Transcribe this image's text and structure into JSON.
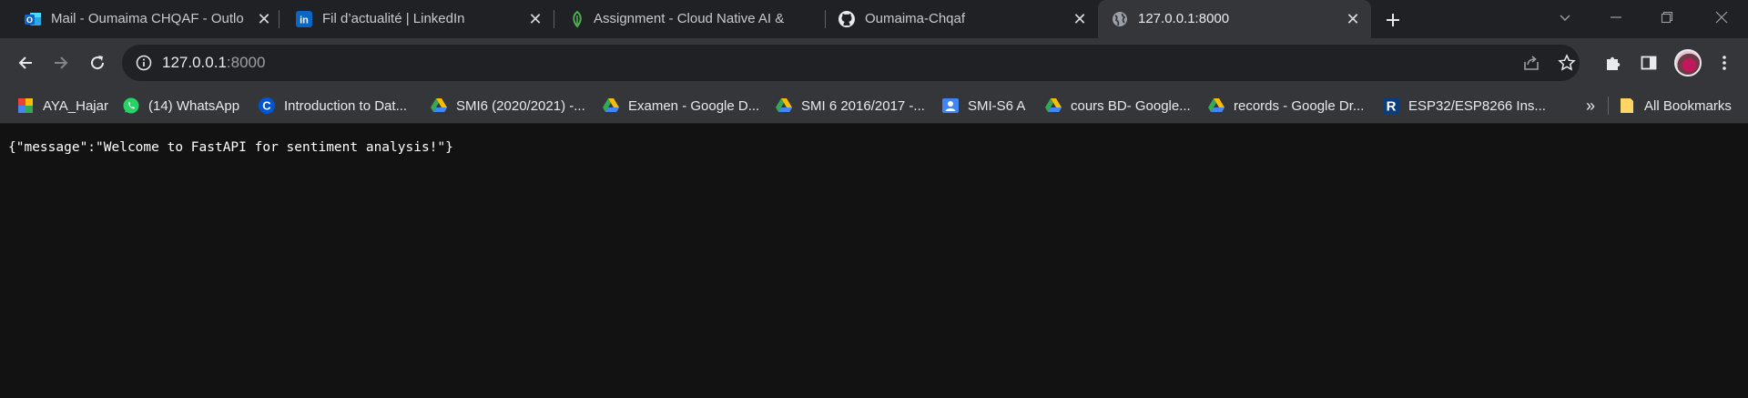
{
  "tabs": [
    {
      "title": "Mail - Oumaima CHQAF - Outlo",
      "icon": "outlook-icon",
      "active": false
    },
    {
      "title": "Fil d’actualité | LinkedIn",
      "icon": "linkedin-icon",
      "active": false
    },
    {
      "title": "Assignment - Cloud Native AI &",
      "icon": "assignment-icon",
      "active": false
    },
    {
      "title": "Oumaima-Chqaf",
      "icon": "github-icon",
      "active": false
    },
    {
      "title": "127.0.0.1:8000",
      "icon": "globe-icon",
      "active": true
    }
  ],
  "omnibox": {
    "host": "127.0.0.1",
    "port": ":8000"
  },
  "bookmarks": [
    {
      "label": "AYA_Hajar",
      "icon": "bookmark-app-icon"
    },
    {
      "label": "(14) WhatsApp",
      "icon": "whatsapp-icon"
    },
    {
      "label": "Introduction to Dat...",
      "icon": "coursera-icon"
    },
    {
      "label": "SMI6 (2020/2021) -...",
      "icon": "google-drive-icon"
    },
    {
      "label": "Examen - Google D...",
      "icon": "google-drive-icon"
    },
    {
      "label": "SMI 6 2016/2017 -...",
      "icon": "google-drive-icon"
    },
    {
      "label": "SMI-S6 A",
      "icon": "classroom-icon"
    },
    {
      "label": "cours BD- Google...",
      "icon": "google-drive-icon"
    },
    {
      "label": "records - Google Dr...",
      "icon": "google-drive-icon"
    },
    {
      "label": "ESP32/ESP8266 Ins...",
      "icon": "r-icon"
    }
  ],
  "bookmarks_more": "»",
  "all_bookmarks": "All Bookmarks",
  "page": {
    "body_text": "{\"message\":\"Welcome to FastAPI for sentiment analysis!\"}"
  },
  "colors": {
    "tabstrip": "#202124",
    "toolbar": "#35363a",
    "page_background": "#121212"
  }
}
